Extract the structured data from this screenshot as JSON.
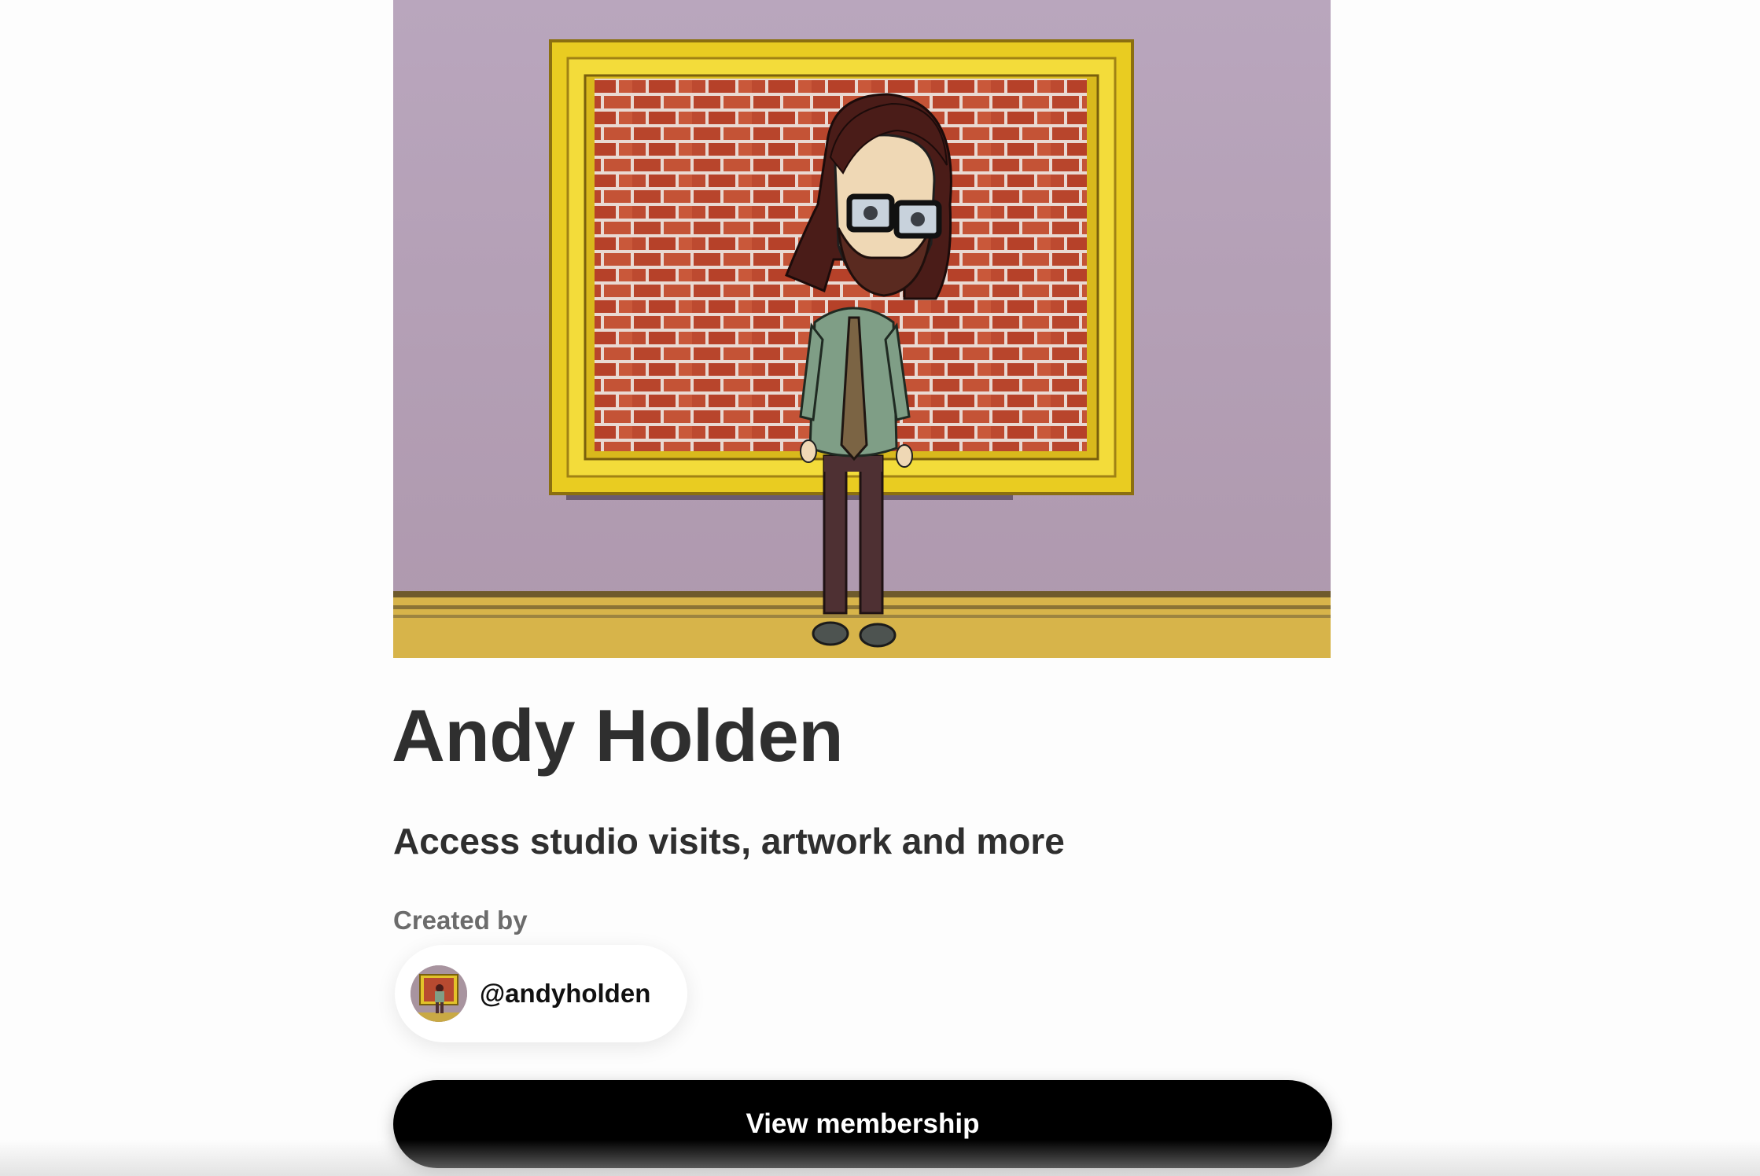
{
  "creator": {
    "name": "Andy Holden",
    "tagline": "Access studio visits, artwork and more",
    "created_by_label": "Created by",
    "handle": "@andyholden"
  },
  "cta": {
    "label": "View membership"
  },
  "hero": {
    "description_icon": "cartoon-portrait-image"
  },
  "colors": {
    "button_background": "#000000",
    "button_text": "#ffffff",
    "title_text": "#2f2f2f",
    "muted_text": "#6b6b6b"
  }
}
